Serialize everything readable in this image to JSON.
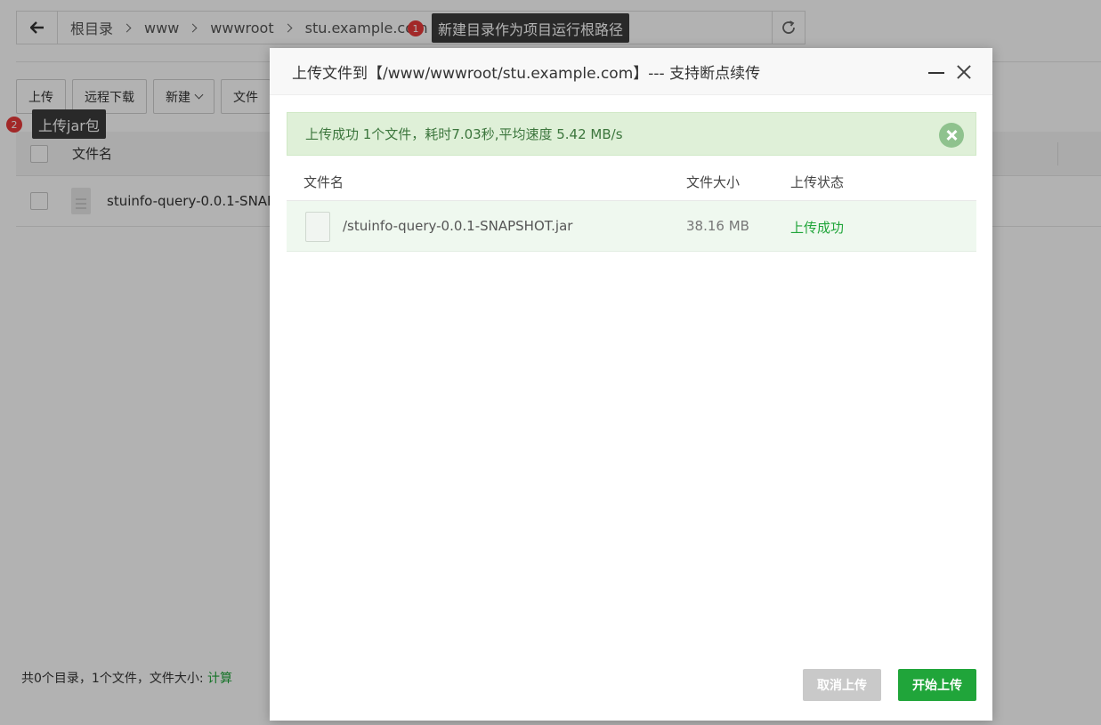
{
  "breadcrumb": {
    "items": [
      "根目录",
      "www",
      "wwwroot",
      "stu.example.com"
    ]
  },
  "toolbar": {
    "upload": "上传",
    "remote_download": "远程下载",
    "new": "新建",
    "file_partial": "文件"
  },
  "table": {
    "header_filename": "文件名",
    "rows": [
      {
        "name": "stuinfo-query-0.0.1-SNAP"
      }
    ]
  },
  "footer": {
    "summary": "共0个目录，1个文件，文件大小: ",
    "calc_link": "计算"
  },
  "annotations": [
    {
      "number": "1",
      "text": "新建目录作为项目运行根路径"
    },
    {
      "number": "2",
      "text": "上传jar包"
    }
  ],
  "modal": {
    "title": "上传文件到【/www/wwwroot/stu.example.com】--- 支持断点续传",
    "success_message": "上传成功 1个文件，耗时7.03秒,平均速度 5.42 MB/s",
    "columns": [
      "文件名",
      "文件大小",
      "上传状态"
    ],
    "files": [
      {
        "name": "/stuinfo-query-0.0.1-SNAPSHOT.jar",
        "size": "38.16 MB",
        "status": "上传成功"
      }
    ],
    "cancel_button": "取消上传",
    "start_button": "开始上传"
  },
  "colors": {
    "accent_green": "#20a53a",
    "success_bg": "#dff0d8",
    "badge_red": "#e83a3a"
  }
}
